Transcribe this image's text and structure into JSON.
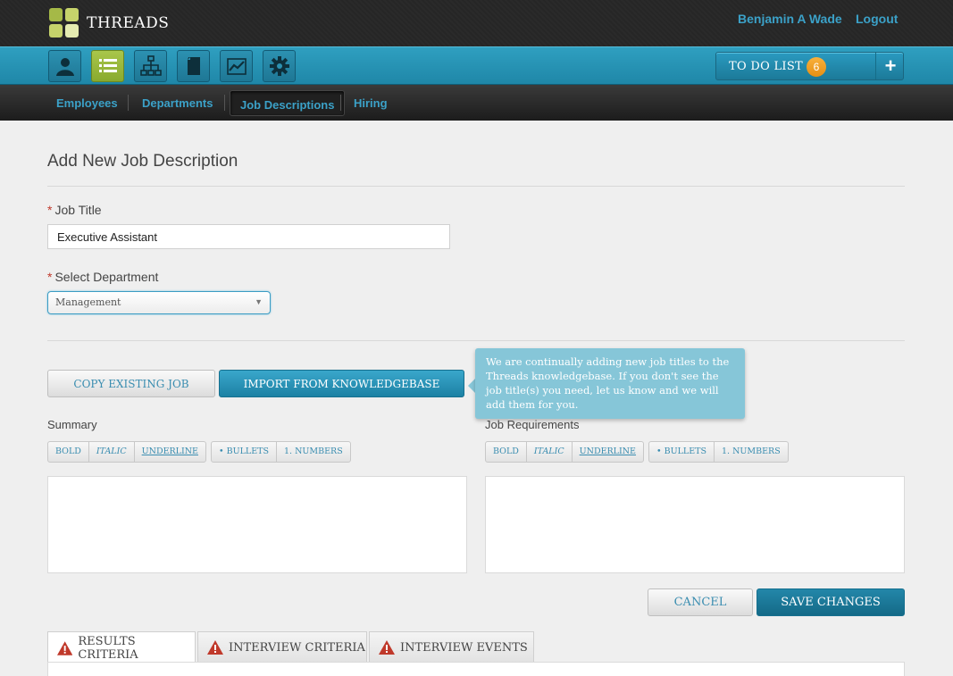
{
  "app": {
    "brand": "THREADS"
  },
  "header": {
    "user_name": "Benjamin A Wade",
    "logout_label": "Logout"
  },
  "toolbar": {
    "icons": [
      "person-icon",
      "list-icon",
      "org-chart-icon",
      "document-icon",
      "chart-icon",
      "gear-icon"
    ],
    "active_index": 1,
    "todo_label": "TO DO LIST",
    "todo_count": "6",
    "todo_add": "+"
  },
  "subnav": {
    "items": [
      "Employees",
      "Departments",
      "Job Descriptions",
      "Hiring"
    ],
    "active": "Job Descriptions"
  },
  "form": {
    "title": "Add New Job Description",
    "job_title_label": "Job Title",
    "job_title_value": "Executive Assistant",
    "department_label": "Select Department",
    "department_value": "Management",
    "required_mark": "*"
  },
  "actions": {
    "copy_label": "COPY EXISTING JOB",
    "import_label": "IMPORT FROM KNOWLEDGEBASE",
    "tooltip_text": "We are continually adding new job titles to the Threads knowledgebase. If you don't see the job title(s) you need, let us know and we will add them for you.",
    "cancel_label": "CANCEL",
    "save_label": "SAVE CHANGES"
  },
  "editors": {
    "summary_label": "Summary",
    "requirements_label": "Job Requirements",
    "toolbar": {
      "bold": "BOLD",
      "italic": "ITALIC",
      "underline": "UNDERLINE",
      "bullets": "• BULLETS",
      "numbers": "1. NUMBERS"
    }
  },
  "tabs": [
    {
      "label": "RESULTS CRITERIA"
    },
    {
      "label": "INTERVIEW CRITERIA"
    },
    {
      "label": "INTERVIEW EVENTS"
    }
  ],
  "colors": {
    "accent_blue": "#2a9ac0",
    "active_green": "#9ab93c",
    "badge_orange": "#f0a028",
    "warning_red": "#c0392b"
  }
}
